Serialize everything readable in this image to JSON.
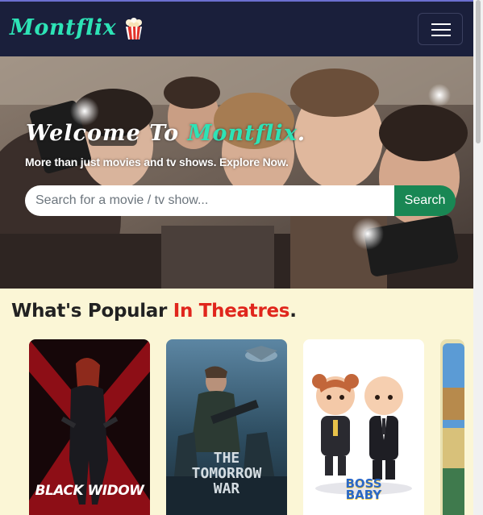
{
  "navbar": {
    "brand": "Montflix",
    "brand_icon": "popcorn-icon",
    "menu_icon": "hamburger-icon"
  },
  "hero": {
    "title_prefix": "Welcome To ",
    "title_accent": "Montflix",
    "title_suffix": ".",
    "subtitle": "More than just movies and tv shows. Explore Now.",
    "search_placeholder": "Search for a movie / tv show...",
    "search_button": "Search"
  },
  "popular": {
    "title_prefix": "What's Popular ",
    "title_accent": "In Theatres",
    "title_suffix": ".",
    "posters": [
      {
        "label": "BLACK WIDOW"
      },
      {
        "label_line1": "THE",
        "label_line2": "TOMORROW",
        "label_line3": "WAR"
      },
      {
        "label_line1": "BOSS",
        "label_line2": "BABY"
      },
      {
        "label": ""
      }
    ]
  },
  "colors": {
    "navbar_bg": "#1a1f3b",
    "brand": "#2de3b6",
    "page_bg": "#fbf6d6",
    "accent_red": "#e0261c",
    "search_button": "#198754"
  }
}
